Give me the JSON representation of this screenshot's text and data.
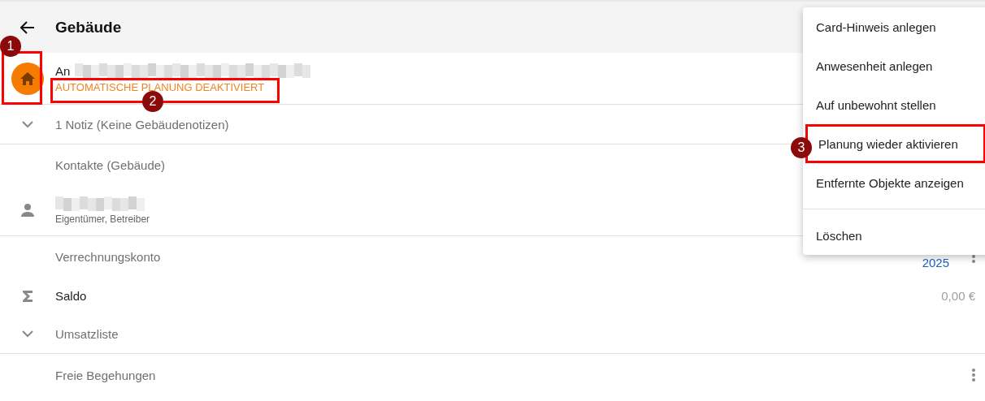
{
  "header": {
    "title": "Gebäude"
  },
  "building": {
    "name_prefix": "An",
    "status": "AUTOMATISCHE PLANUNG DEAKTIVIERT"
  },
  "notes": {
    "label": "1 Notiz (Keine Gebäudenotizen)",
    "expanded": false
  },
  "contacts": {
    "heading": "Kontakte (Gebäude)",
    "items": [
      {
        "roles": "Eigentümer, Betreiber"
      }
    ]
  },
  "account": {
    "heading": "Verrechnungskonto",
    "year": "2025",
    "balance_label": "Saldo",
    "balance": "0,00 €",
    "transactions": {
      "label": "Umsatzliste",
      "expanded": false
    }
  },
  "inspections": {
    "heading": "Freie Begehungen"
  },
  "menu": {
    "groups": [
      [
        {
          "label": "Card-Hinweis anlegen",
          "framed": false
        },
        {
          "label": "Anwesenheit anlegen",
          "framed": false
        },
        {
          "label": "Auf unbewohnt stellen",
          "framed": false
        },
        {
          "label": "Planung wieder aktivieren",
          "framed": true
        },
        {
          "label": "Entfernte Objekte anzeigen",
          "framed": false
        }
      ],
      [
        {
          "label": "Löschen",
          "framed": false
        }
      ]
    ]
  },
  "annotations": [
    {
      "number": "1"
    },
    {
      "number": "2"
    },
    {
      "number": "3"
    }
  ]
}
